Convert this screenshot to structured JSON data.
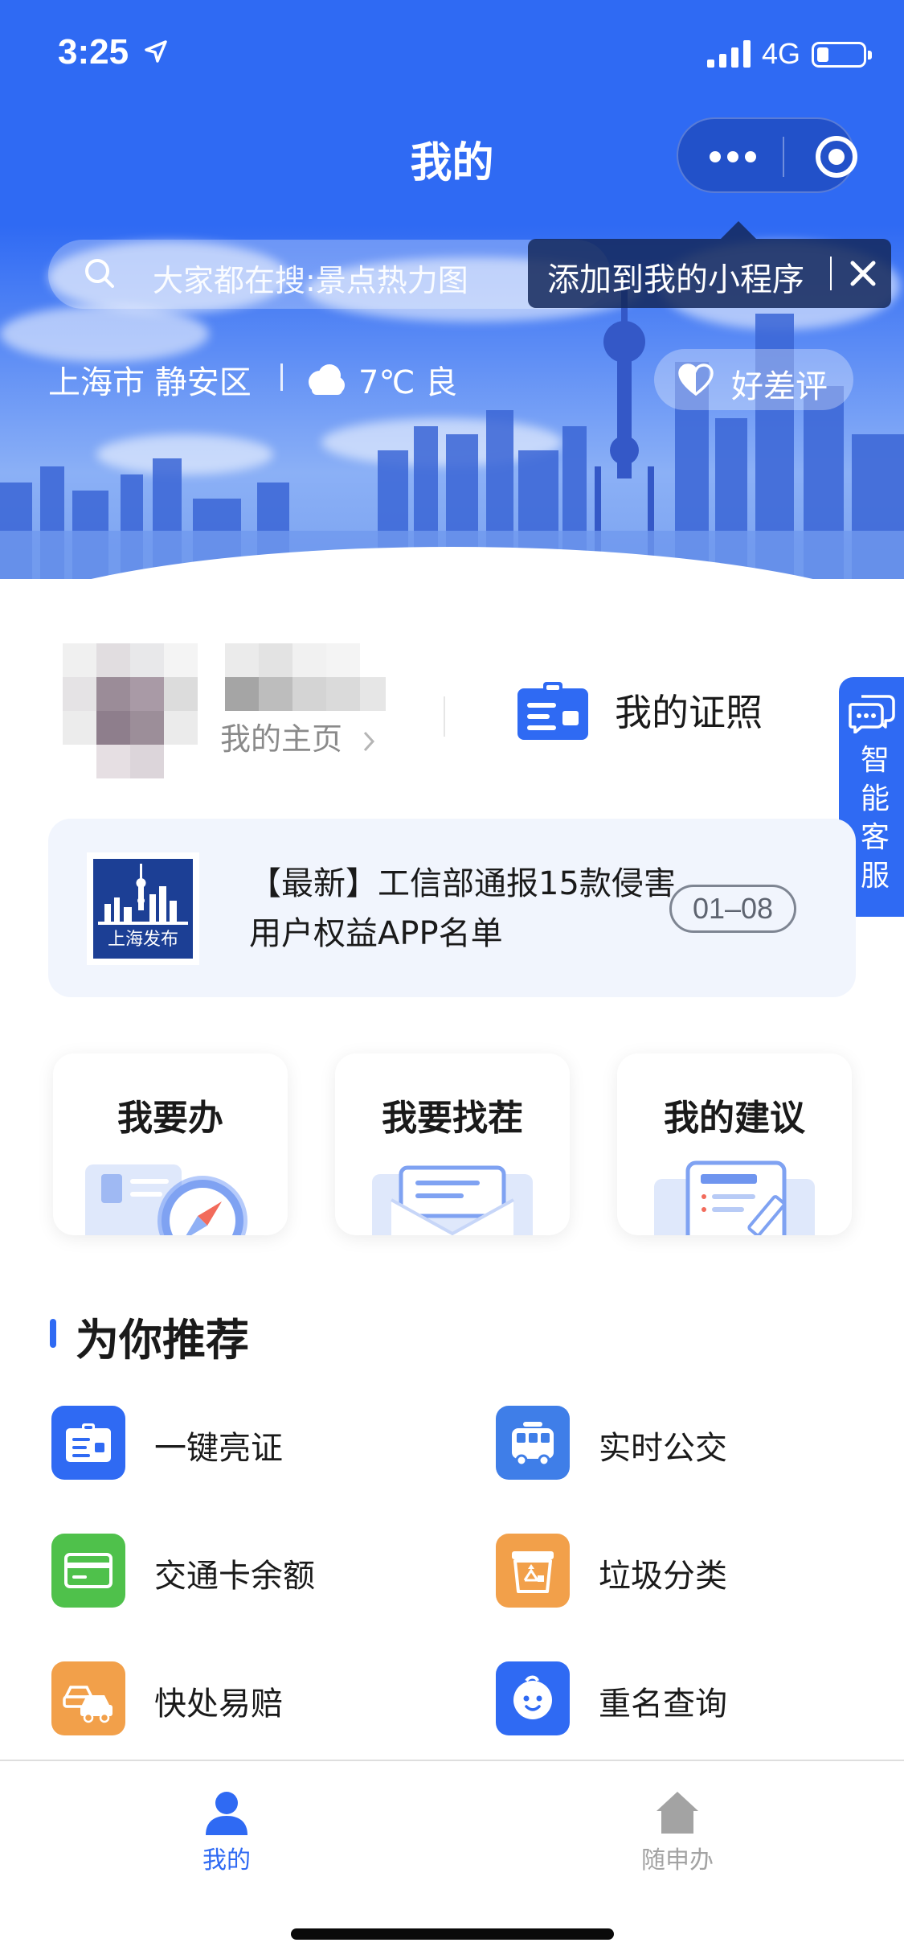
{
  "status_bar": {
    "time": "3:25",
    "network": "4G",
    "battery_level": 0.25
  },
  "nav": {
    "title": "我的",
    "more_icon": "more-dots-icon",
    "close_icon": "target-icon"
  },
  "search": {
    "placeholder": "大家都在搜:景点热力图"
  },
  "tooltip": {
    "text": "添加到我的小程序"
  },
  "location": {
    "city_district": "上海市 静安区",
    "weather": "7℃ 良",
    "review_label": "好差评"
  },
  "profile": {
    "home_link": "我的主页",
    "license_label": "我的证照"
  },
  "side_service": {
    "label": "智能客服"
  },
  "news": {
    "title": "【最新】工信部通报15款侵害用户权益APP名单",
    "date": "01–08",
    "logo_caption": "上海发布"
  },
  "actions": [
    {
      "label": "我要办"
    },
    {
      "label": "我要找茬"
    },
    {
      "label": "我的建议"
    }
  ],
  "recommend": {
    "title": "为你推荐",
    "items": [
      {
        "label": "一键亮证",
        "icon": "id-card-icon",
        "color": "#2f6af3"
      },
      {
        "label": "实时公交",
        "icon": "bus-icon",
        "color": "#3f7ee8"
      },
      {
        "label": "交通卡余额",
        "icon": "transit-card-icon",
        "color": "#4fc14b"
      },
      {
        "label": "垃圾分类",
        "icon": "trash-sort-icon",
        "color": "#f2a04a"
      },
      {
        "label": "快处易赔",
        "icon": "car-accident-icon",
        "color": "#f2a04a"
      },
      {
        "label": "重名查询",
        "icon": "baby-face-icon",
        "color": "#2f6af3"
      }
    ]
  },
  "tabs": [
    {
      "label": "我的",
      "icon": "person-icon",
      "active": true
    },
    {
      "label": "随申办",
      "icon": "home-icon",
      "active": false
    }
  ],
  "colors": {
    "primary": "#2f6af3",
    "tab_inactive": "#a3a3a3"
  }
}
